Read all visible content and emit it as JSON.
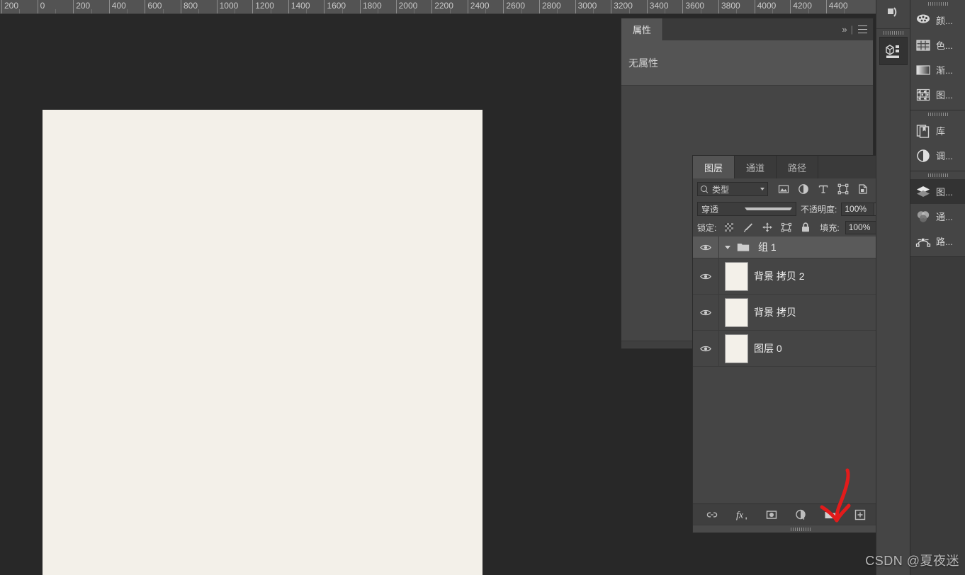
{
  "ruler": {
    "unit_labels": [
      "200",
      "0",
      "200",
      "400",
      "600",
      "800",
      "1000",
      "1200",
      "1400",
      "1600",
      "1800",
      "2000",
      "2200",
      "2400",
      "2600",
      "2800",
      "3000",
      "3200",
      "3400",
      "3600",
      "3800",
      "4000",
      "4200",
      "4400"
    ],
    "collapse_glyph": "⌃"
  },
  "properties_panel": {
    "tabs": [
      {
        "label": "属性",
        "active": true
      }
    ],
    "empty_text": "无属性",
    "collapse_glyph": "»"
  },
  "layers_panel": {
    "tabs": [
      {
        "label": "图层",
        "active": true
      },
      {
        "label": "通道",
        "active": false
      },
      {
        "label": "路径",
        "active": false
      }
    ],
    "collapse_glyph": "»",
    "filter": {
      "kind_label": "类型",
      "icons": [
        "pixel-filter-icon",
        "adjustment-filter-icon",
        "text-filter-icon",
        "shape-filter-icon",
        "smart-object-filter-icon"
      ],
      "toggle_on": true
    },
    "blend": {
      "mode": "穿透",
      "opacity_label": "不透明度:",
      "opacity_value": "100%"
    },
    "lock": {
      "label": "锁定:",
      "icons": [
        "lock-transparency-icon",
        "lock-image-icon",
        "lock-position-icon",
        "lock-artboard-icon",
        "lock-all-icon"
      ],
      "fill_label": "填充:",
      "fill_value": "100%"
    },
    "layers": [
      {
        "name": "组 1",
        "type": "group",
        "visible": true,
        "selected": true,
        "expanded": true
      },
      {
        "name": "背景 拷贝 2",
        "type": "raster",
        "visible": true,
        "selected": false
      },
      {
        "name": "背景 拷贝",
        "type": "raster",
        "visible": true,
        "selected": false
      },
      {
        "name": "图层 0",
        "type": "raster",
        "visible": true,
        "selected": false
      }
    ],
    "bottom_buttons": [
      "link-layers-icon",
      "layer-style-fx-icon",
      "add-mask-icon",
      "new-adjustment-layer-icon",
      "new-group-icon",
      "new-layer-icon",
      "delete-layer-icon"
    ]
  },
  "right_dock": {
    "group1": [
      {
        "label": "颜...",
        "icon": "color-palette-icon",
        "active": false
      },
      {
        "label": "色...",
        "icon": "swatches-grid-icon",
        "active": false
      },
      {
        "label": "渐...",
        "icon": "gradient-icon",
        "active": false
      },
      {
        "label": "图...",
        "icon": "patterns-icon",
        "active": false
      }
    ],
    "group2": [
      {
        "label": "库",
        "icon": "libraries-icon",
        "active": false
      },
      {
        "label": "调...",
        "icon": "adjustments-icon",
        "active": false
      }
    ],
    "group3": [
      {
        "label": "图...",
        "icon": "layers-icon",
        "active": true
      },
      {
        "label": "通...",
        "icon": "channels-icon",
        "active": false
      },
      {
        "label": "路...",
        "icon": "paths-icon",
        "active": false
      }
    ],
    "sliver_buttons": [
      "comment-icon",
      "properties-3d-icon"
    ]
  },
  "canvas": {
    "document_color": "#f3f0e9",
    "background_color": "#282828"
  },
  "annotation": {
    "arrow_color": "#e31b1b",
    "points_at": "new-group-icon"
  },
  "watermark": {
    "text": "CSDN @夏夜迷"
  }
}
